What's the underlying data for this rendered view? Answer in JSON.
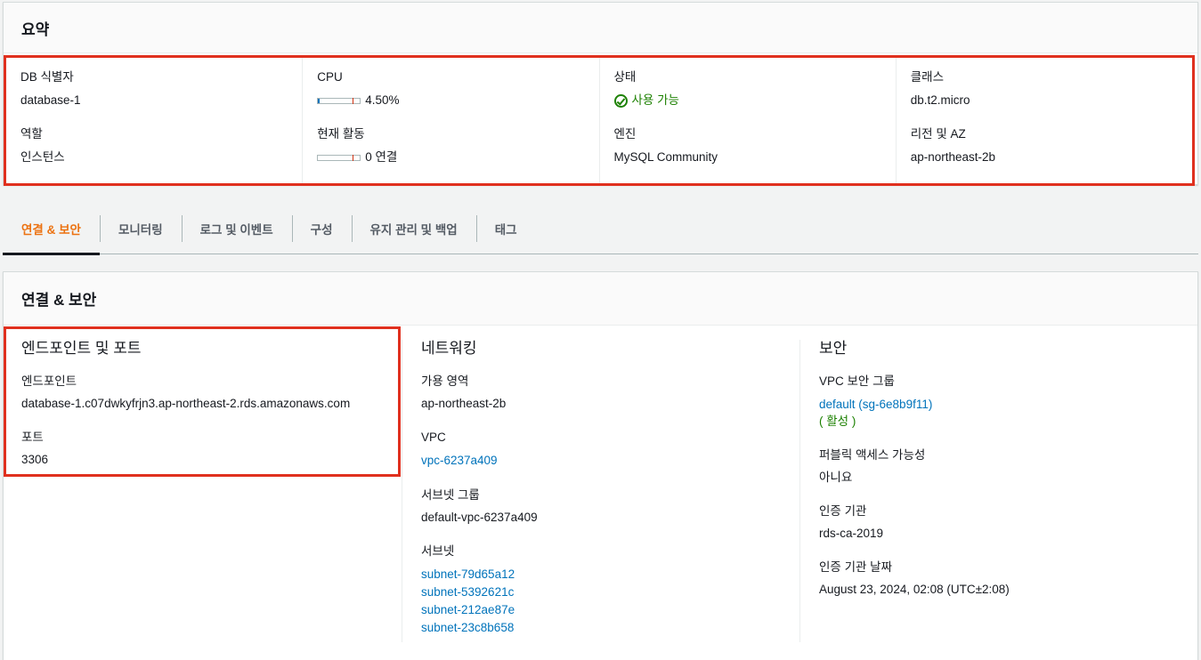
{
  "summary": {
    "title": "요약",
    "columns": [
      {
        "items": [
          {
            "label": "DB 식별자",
            "value": "database-1"
          },
          {
            "label": "역할",
            "value": "인스턴스"
          }
        ]
      },
      {
        "cpu_label": "CPU",
        "cpu_value": "4.50%",
        "cpu_utilization_percent": 4.5,
        "activity_label": "현재 활동",
        "activity_value": "0 연결",
        "activity_connections": 0
      },
      {
        "status_label": "상태",
        "status_value": "사용 가능",
        "engine_label": "엔진",
        "engine_value": "MySQL Community"
      },
      {
        "items": [
          {
            "label": "클래스",
            "value": "db.t2.micro"
          },
          {
            "label": "리전 및 AZ",
            "value": "ap-northeast-2b"
          }
        ]
      }
    ]
  },
  "tabs": [
    "연결 & 보안",
    "모니터링",
    "로그 및 이벤트",
    "구성",
    "유지 관리 및 백업",
    "태그"
  ],
  "active_tab": 0,
  "connectivity": {
    "title": "연결 & 보안",
    "endpoint_section": {
      "title": "엔드포인트 및 포트",
      "endpoint_label": "엔드포인트",
      "endpoint_value": "database-1.c07dwkyfrjn3.ap-northeast-2.rds.amazonaws.com",
      "port_label": "포트",
      "port_value": "3306"
    },
    "network_section": {
      "title": "네트워킹",
      "az_label": "가용 영역",
      "az_value": "ap-northeast-2b",
      "vpc_label": "VPC",
      "vpc_value": "vpc-6237a409",
      "subnet_group_label": "서브넷 그룹",
      "subnet_group_value": "default-vpc-6237a409",
      "subnets_label": "서브넷",
      "subnets": [
        "subnet-79d65a12",
        "subnet-5392621c",
        "subnet-212ae87e",
        "subnet-23c8b658"
      ]
    },
    "security_section": {
      "title": "보안",
      "sg_label": "VPC 보안 그룹",
      "sg_value": "default (sg-6e8b9f11)",
      "sg_status": "( 활성 )",
      "public_label": "퍼블릭 액세스 가능성",
      "public_value": "아니요",
      "ca_label": "인증 기관",
      "ca_value": "rds-ca-2019",
      "ca_date_label": "인증 기관 날짜",
      "ca_date_value": "August 23, 2024, 02:08 (UTC±2:08)"
    }
  },
  "colors": {
    "accent_tab": "#ec7211",
    "link": "#0073bb",
    "success": "#1d8102",
    "highlight_box": "#e0301e"
  }
}
